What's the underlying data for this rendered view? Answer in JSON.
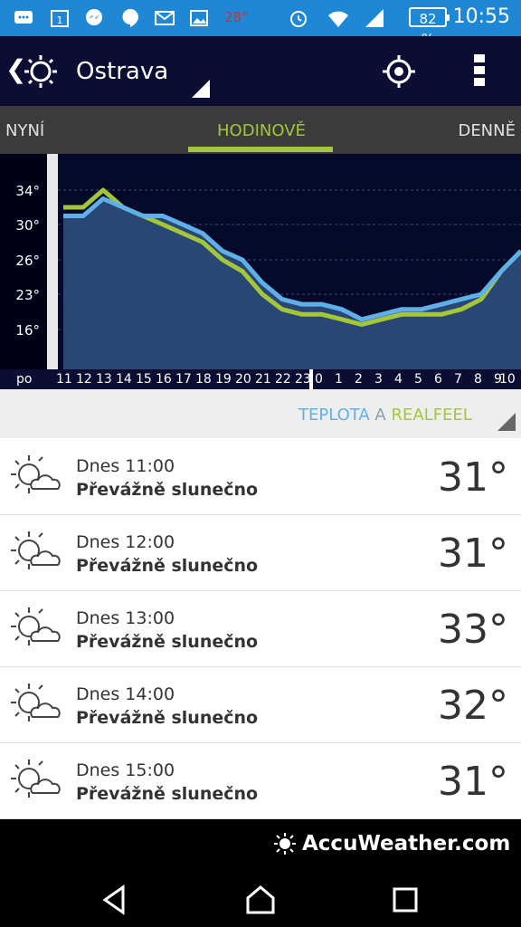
{
  "statusbar": {
    "time": "10:55",
    "battery": "82 %",
    "temp_notification": "28°",
    "icons": [
      "chat-icon",
      "calendar-icon",
      "messenger-icon",
      "hangouts-icon",
      "gmail-icon",
      "gallery-icon",
      "alarm-icon",
      "wifi-icon",
      "signal-icon",
      "battery-icon"
    ]
  },
  "appbar": {
    "back": "❮",
    "city": "Ostrava",
    "icons": [
      "sun-icon",
      "location-icon",
      "menu-icon"
    ]
  },
  "tabs": {
    "now": "NYNÍ",
    "hourly": "HODINOVĚ",
    "daily": "DENNĚ"
  },
  "chart": {
    "y_ticks": [
      "34°",
      "30°",
      "26°",
      "23°",
      "16°"
    ],
    "x_labels": [
      "po",
      "11",
      "12",
      "13",
      "14",
      "15",
      "16",
      "17",
      "18",
      "19",
      "20",
      "21",
      "22",
      "23",
      "0",
      "1",
      "2",
      "3",
      "4",
      "5",
      "6",
      "7",
      "8",
      "9",
      "10"
    ]
  },
  "chart_data": {
    "type": "line",
    "x": [
      "11",
      "12",
      "13",
      "14",
      "15",
      "16",
      "17",
      "18",
      "19",
      "20",
      "21",
      "22",
      "23",
      "0",
      "1",
      "2",
      "3",
      "4",
      "5",
      "6",
      "7",
      "8",
      "9",
      "10"
    ],
    "series": [
      {
        "name": "TEPLOTA",
        "color": "#5fb0e8",
        "values": [
          31,
          31,
          33,
          32,
          31,
          31,
          30,
          29,
          27,
          26,
          24,
          22,
          21,
          21,
          20,
          18,
          19,
          20,
          20,
          21,
          22,
          23,
          25,
          27
        ]
      },
      {
        "name": "REALFEEL",
        "color": "#a4c639",
        "values": [
          32,
          32,
          34,
          32,
          31,
          30,
          29,
          28,
          26,
          25,
          23,
          20,
          19,
          19,
          18,
          17,
          18,
          19,
          19,
          19,
          20,
          22,
          25,
          27
        ]
      }
    ]
  },
  "legend": {
    "temp": "TEPLOTA",
    "and": " A ",
    "realfeel": "REALFEEL"
  },
  "list": [
    {
      "time": "Dnes 11:00",
      "desc": "Převážně slunečno",
      "temp": "31°"
    },
    {
      "time": "Dnes 12:00",
      "desc": "Převážně slunečno",
      "temp": "31°"
    },
    {
      "time": "Dnes 13:00",
      "desc": "Převážně slunečno",
      "temp": "33°"
    },
    {
      "time": "Dnes 14:00",
      "desc": "Převážně slunečno",
      "temp": "32°"
    },
    {
      "time": "Dnes 15:00",
      "desc": "Převážně slunečno",
      "temp": "31°"
    }
  ],
  "footer": {
    "brand": "AccuWeather.com"
  }
}
